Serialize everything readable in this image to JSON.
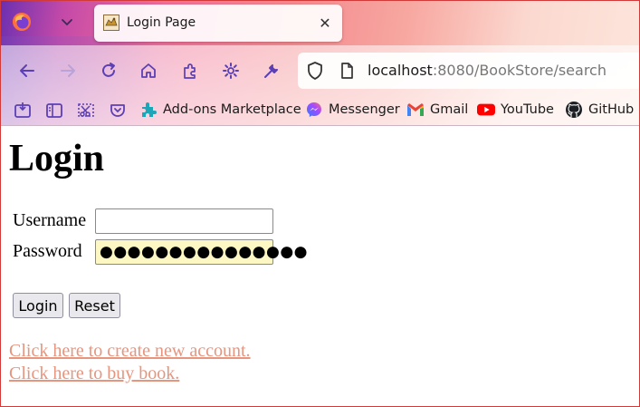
{
  "tab": {
    "title": "Login Page",
    "close_glyph": "✕"
  },
  "urlbar": {
    "host": "localhost",
    "rest": ":8080/BookStore/search"
  },
  "bookmarks": [
    {
      "label": "Add-ons Marketplace",
      "icon": "addons-puzzle-icon"
    },
    {
      "label": "Messenger",
      "icon": "messenger-icon"
    },
    {
      "label": "Gmail",
      "icon": "gmail-icon"
    },
    {
      "label": "YouTube",
      "icon": "youtube-icon"
    },
    {
      "label": "GitHub",
      "icon": "github-icon"
    }
  ],
  "page": {
    "heading": "Login",
    "username_label": "Username",
    "password_label": "Password",
    "username_value": "",
    "password_value": "●●●●●●●●●●●●●●●",
    "login_button": "Login",
    "reset_button": "Reset",
    "create_account_link": "Click here to create new account.",
    "buy_book_link": "Click here to buy book."
  },
  "colors": {
    "link": "#e6957f",
    "autofill_bg": "#fdf8c3",
    "toolbar_icon": "#5b3fb5",
    "frame_border": "#d23a3a"
  }
}
